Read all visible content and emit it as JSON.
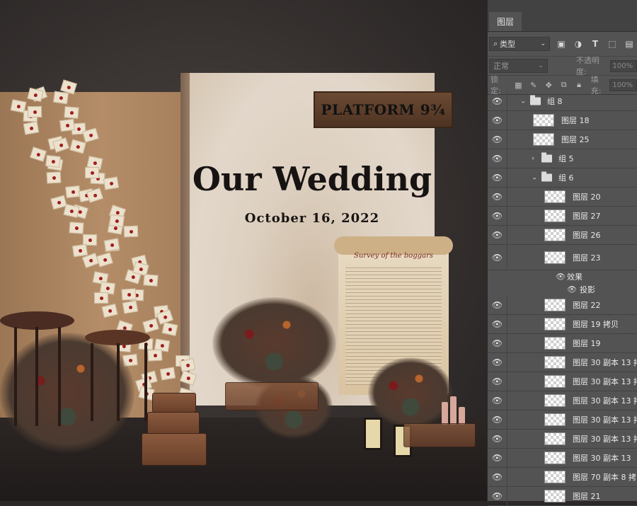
{
  "canvas": {
    "sign_text": "PLATFORM 9¾",
    "title": "Our Wedding",
    "date": "October 16, 2022",
    "scroll_title": "Survey of the boggars"
  },
  "panel": {
    "tab_label": "图层",
    "filter_select": "类型",
    "blend_mode": "正常",
    "opacity_label": "不透明度:",
    "opacity_value": "100%",
    "lock_label": "锁定:",
    "fill_label": "填充:",
    "fill_value": "100%",
    "toolbar_icons": [
      "image-filter-icon",
      "adjustment-filter-icon",
      "type-filter-icon",
      "shape-filter-icon",
      "smart-object-filter-icon"
    ],
    "lock_icons": [
      "lock-transparent-icon",
      "lock-image-icon",
      "lock-position-icon",
      "lock-artboard-icon",
      "lock-all-icon"
    ]
  },
  "layers": [
    {
      "name": "组 8",
      "kind": "group",
      "expanded": true,
      "level": 0
    },
    {
      "name": "图层 18",
      "kind": "layer",
      "level": 1
    },
    {
      "name": "图层 25",
      "kind": "layer",
      "level": 1
    },
    {
      "name": "组 5",
      "kind": "group",
      "expanded": false,
      "level": 1
    },
    {
      "name": "组 6",
      "kind": "group",
      "expanded": true,
      "level": 1
    },
    {
      "name": "图层 20",
      "kind": "layer",
      "level": 2
    },
    {
      "name": "图层 27",
      "kind": "layer",
      "level": 2
    },
    {
      "name": "图层 26",
      "kind": "layer",
      "level": 2
    },
    {
      "name": "图层 23",
      "kind": "layer",
      "level": 2,
      "tall": true,
      "effects_label": "效果",
      "effect": "投影"
    },
    {
      "name": "图层 22",
      "kind": "layer",
      "level": 2
    },
    {
      "name": "图层 19 拷贝",
      "kind": "layer",
      "level": 2
    },
    {
      "name": "图层 19",
      "kind": "layer",
      "level": 2
    },
    {
      "name": "图层 30 副本 13 拷",
      "kind": "layer",
      "level": 2
    },
    {
      "name": "图层 30 副本 13 拷",
      "kind": "layer",
      "level": 2
    },
    {
      "name": "图层 30 副本 13 拷",
      "kind": "layer",
      "level": 2
    },
    {
      "name": "图层 30 副本 13 拷",
      "kind": "layer",
      "level": 2
    },
    {
      "name": "图层 30 副本 13 拷",
      "kind": "layer",
      "level": 2
    },
    {
      "name": "图层 30 副本 13",
      "kind": "layer",
      "level": 2
    },
    {
      "name": "图层 70 副本 8 拷",
      "kind": "layer",
      "level": 2
    },
    {
      "name": "图层 21",
      "kind": "layer",
      "level": 2
    }
  ]
}
